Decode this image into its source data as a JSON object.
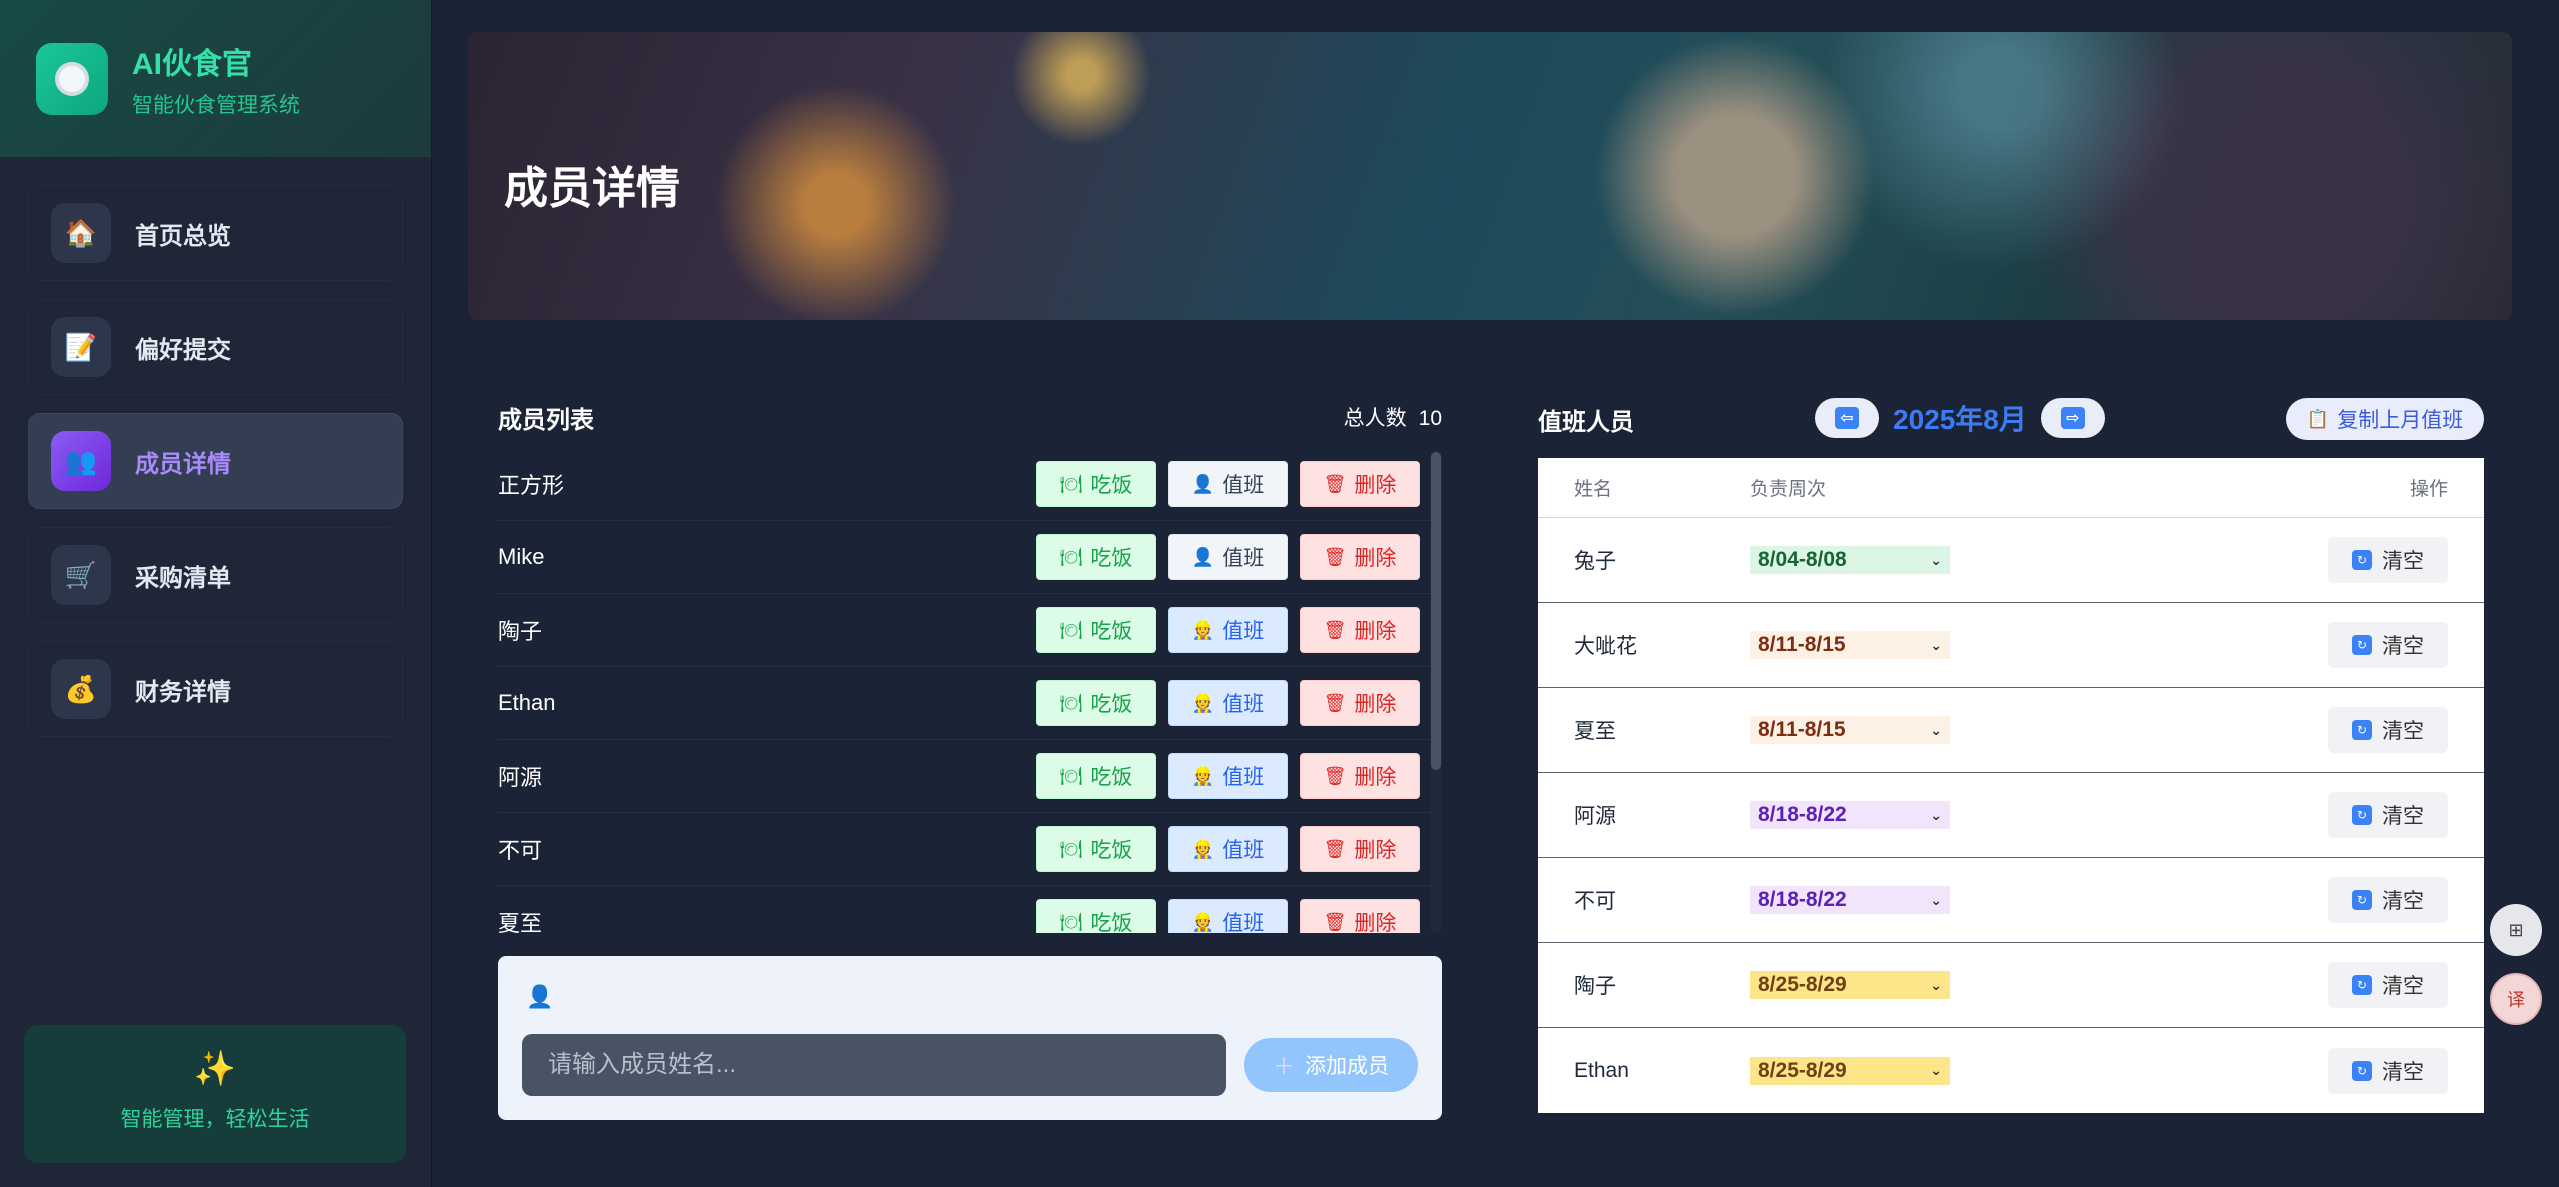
{
  "brand": {
    "title": "AI伙食官",
    "subtitle": "智能伙食管理系统"
  },
  "nav": [
    {
      "label": "首页总览",
      "icon": "🏠"
    },
    {
      "label": "偏好提交",
      "icon": "📝"
    },
    {
      "label": "成员详情",
      "icon": "👥",
      "active": true
    },
    {
      "label": "采购清单",
      "icon": "🛒"
    },
    {
      "label": "财务详情",
      "icon": "💰"
    }
  ],
  "sidebar_footer": {
    "icon": "✨",
    "text": "智能管理，轻松生活"
  },
  "banner": {
    "title": "成员详情"
  },
  "members": {
    "title": "成员列表",
    "count_label": "总人数",
    "count": "10",
    "eat_label": "吃饭",
    "duty_label": "值班",
    "delete_label": "删除",
    "rows": [
      {
        "name": "正方形",
        "duty_on": false
      },
      {
        "name": "Mike",
        "duty_on": false
      },
      {
        "name": "陶子",
        "duty_on": true
      },
      {
        "name": "Ethan",
        "duty_on": true
      },
      {
        "name": "阿源",
        "duty_on": true
      },
      {
        "name": "不可",
        "duty_on": true
      },
      {
        "name": "夏至",
        "duty_on": true
      }
    ]
  },
  "add_member": {
    "placeholder": "请输入成员姓名...",
    "button_label": "添加成员"
  },
  "duty": {
    "title": "值班人员",
    "month": "2025年8月",
    "copy_label": "复制上月值班",
    "headers": {
      "name": "姓名",
      "week": "负责周次",
      "op": "操作"
    },
    "clear_label": "清空",
    "rows": [
      {
        "name": "兔子",
        "week": "8/04-8/08",
        "bg": "#dcf5e4",
        "fg": "#166534"
      },
      {
        "name": "大呲花",
        "week": "8/11-8/15",
        "bg": "#fdf0e4",
        "fg": "#7c2d12"
      },
      {
        "name": "夏至",
        "week": "8/11-8/15",
        "bg": "#fdf0e4",
        "fg": "#7c2d12"
      },
      {
        "name": "阿源",
        "week": "8/18-8/22",
        "bg": "#f1e4fb",
        "fg": "#5b21b6"
      },
      {
        "name": "不可",
        "week": "8/18-8/22",
        "bg": "#f1e4fb",
        "fg": "#5b21b6"
      },
      {
        "name": "陶子",
        "week": "8/25-8/29",
        "bg": "#fde68a",
        "fg": "#713f12"
      },
      {
        "name": "Ethan",
        "week": "8/25-8/29",
        "bg": "#fde68a",
        "fg": "#713f12"
      }
    ]
  }
}
